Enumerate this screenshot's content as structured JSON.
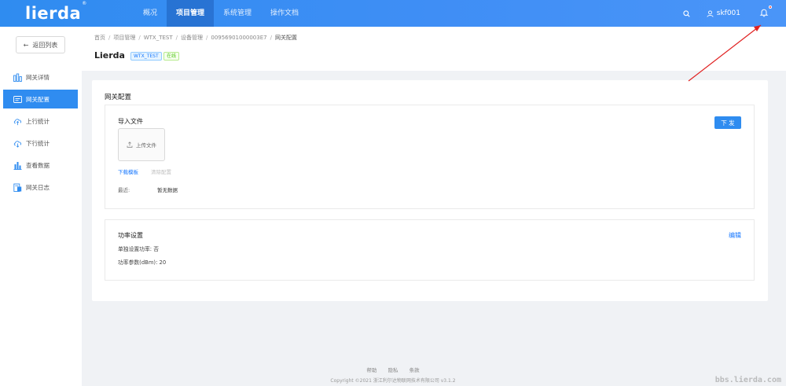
{
  "app": {
    "logo": "lierda",
    "logo_mark": "®"
  },
  "topnav": {
    "items": [
      {
        "label": "概况",
        "active": false
      },
      {
        "label": "项目管理",
        "active": true
      },
      {
        "label": "系统管理",
        "active": false
      },
      {
        "label": "操作文档",
        "active": false
      }
    ],
    "user": "skf001",
    "icons": [
      "search-icon",
      "user-icon",
      "bell-icon"
    ],
    "colors": {
      "bar": "#2f8cf0",
      "notification_dot": "#ff3b30"
    }
  },
  "sidebar": {
    "back_label": "返回列表",
    "items": [
      {
        "label": "网关详情",
        "icon": "dashboard-icon",
        "active": false
      },
      {
        "label": "网关配置",
        "icon": "settings-icon",
        "active": true
      },
      {
        "label": "上行统计",
        "icon": "cloud-upload-icon",
        "active": false
      },
      {
        "label": "下行统计",
        "icon": "cloud-download-icon",
        "active": false
      },
      {
        "label": "查看数据",
        "icon": "bar-chart-icon",
        "active": false
      },
      {
        "label": "网关日志",
        "icon": "log-icon",
        "active": false
      }
    ]
  },
  "breadcrumb": [
    "首页",
    "项目管理",
    "WTX_TEST",
    "设备管理",
    "00956901000003E7",
    "网关配置"
  ],
  "page": {
    "title": "Lierda",
    "tag_project": "WTX_TEST",
    "tag_status": "在线"
  },
  "main": {
    "card_title": "网关配置",
    "import": {
      "title": "导入文件",
      "send_label": "下 发",
      "upload_label": "上传文件",
      "download_template": "下载模板",
      "clear_config": "清除配置",
      "recent_label": "最近:",
      "recent_value": "暂无数据"
    },
    "power": {
      "title": "功率设置",
      "edit_label": "编辑",
      "single_power": "单独设置功率:  否",
      "power_param": "功率参数(dBm):  20"
    }
  },
  "footer": {
    "links": [
      "帮助",
      "隐私",
      "条款"
    ],
    "copyright": "Copyright ©2021 浙江利尔达物联网技术有限公司 v3.1.2",
    "watermark": "bbs.lierda.com"
  }
}
